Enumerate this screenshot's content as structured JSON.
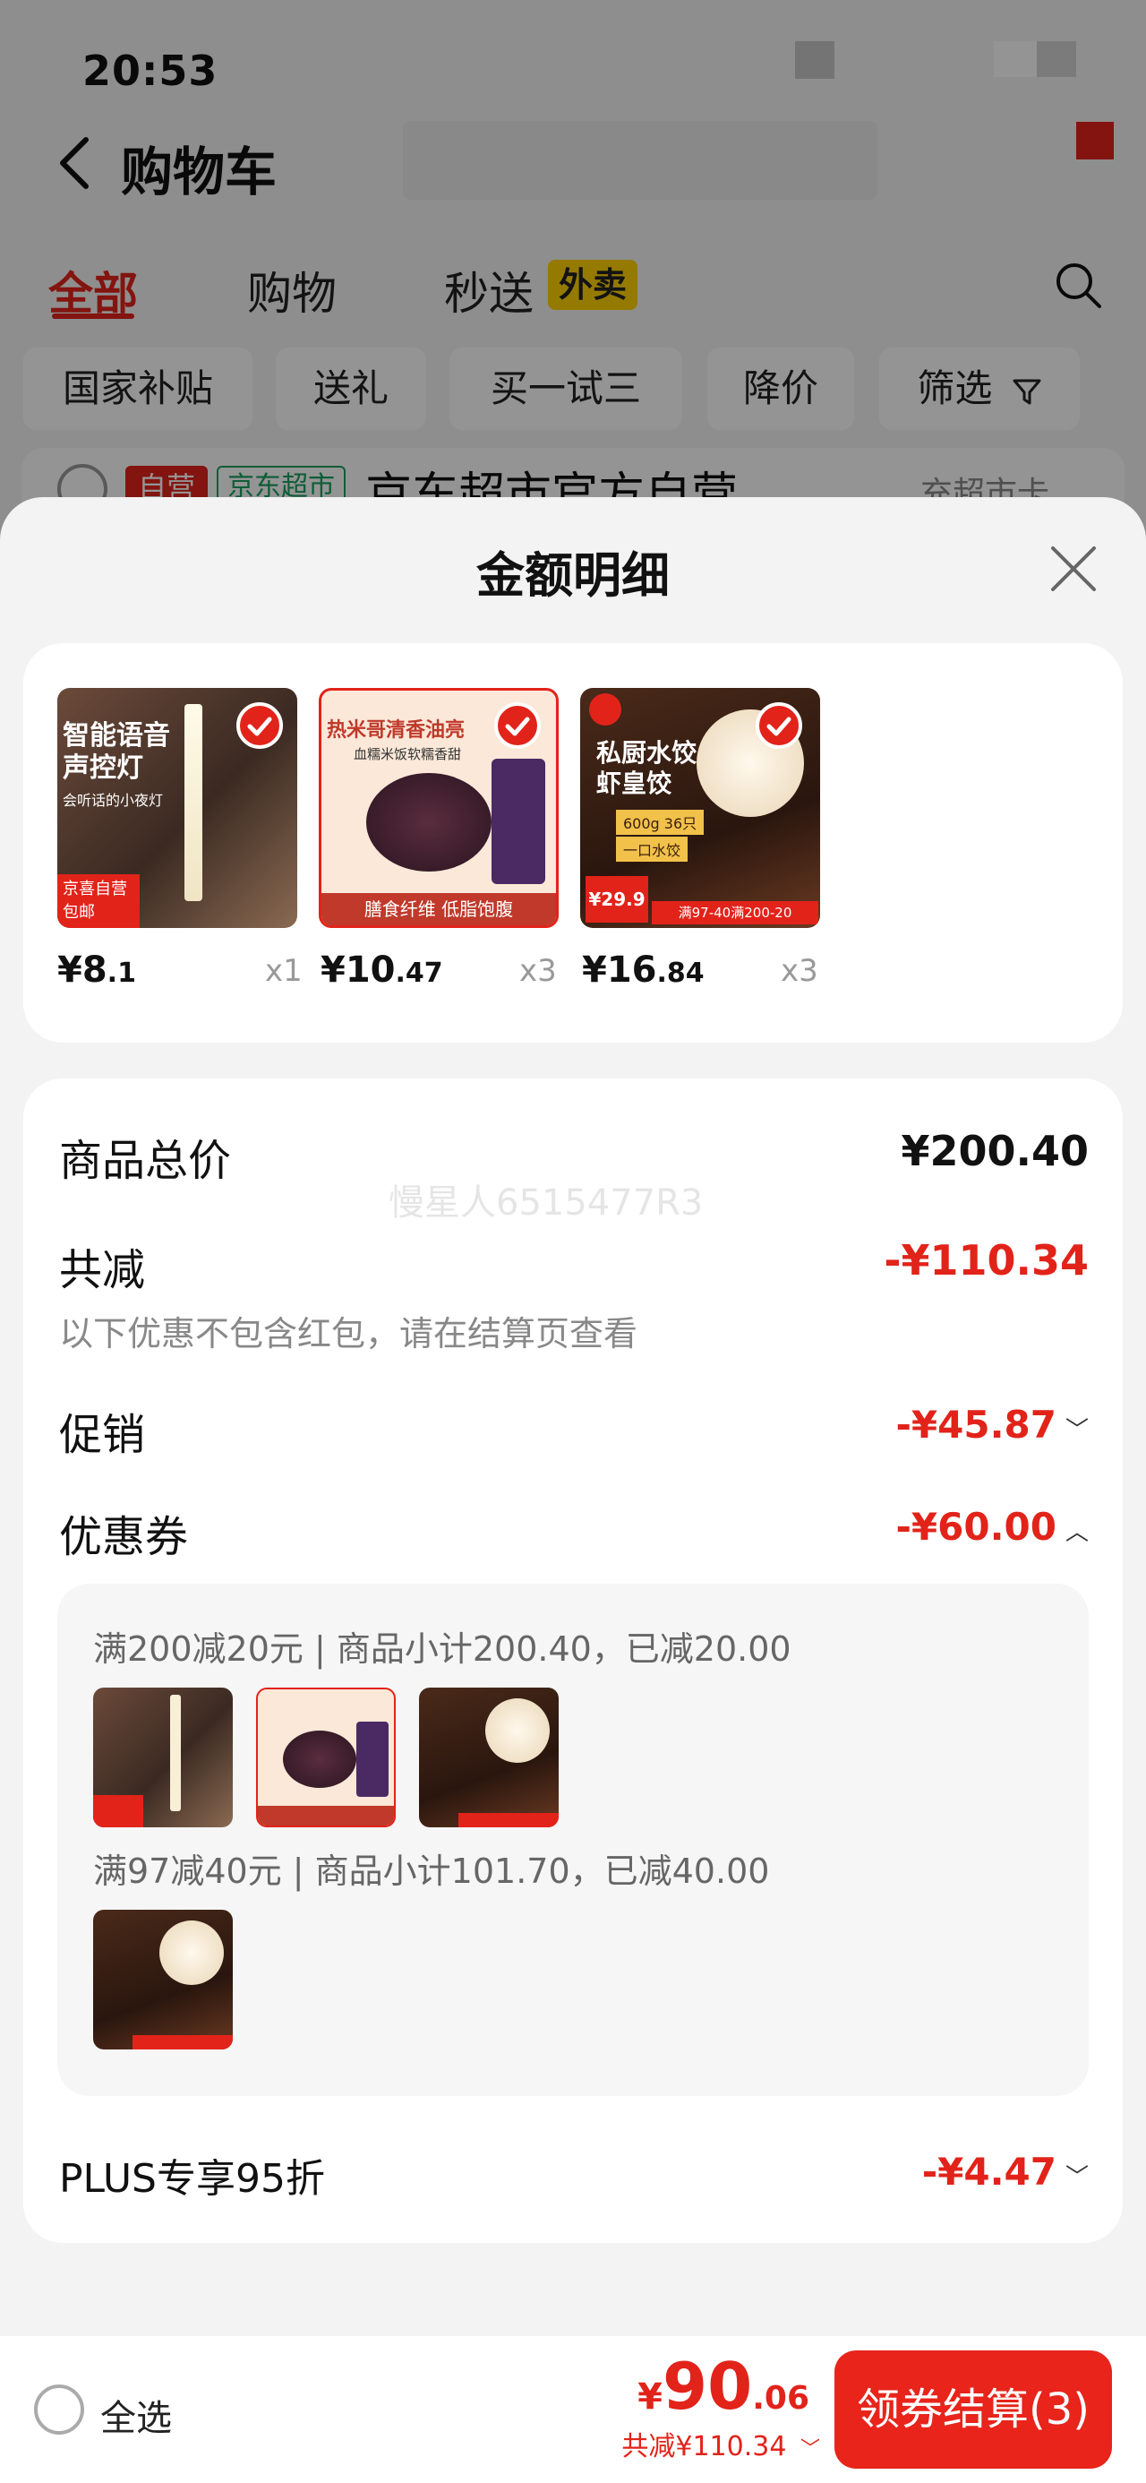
{
  "status_bar": {
    "time": "20:53"
  },
  "cart": {
    "title": "购物车",
    "tabs": [
      "全部",
      "购物",
      "秒送"
    ],
    "takeaway_badge": "外卖",
    "chips": [
      "国家补贴",
      "送礼",
      "买一试三",
      "降价",
      "筛选"
    ],
    "store": {
      "badge_self": "自营",
      "badge_jd": "京东超市",
      "name": "京东超市官方自营",
      "link": "充超市卡"
    }
  },
  "sheet": {
    "title": "金额明细",
    "products": [
      {
        "name": "智能语音声控灯",
        "price_int": "¥8",
        "price_dec": ".1",
        "qty": "x1",
        "selected": true
      },
      {
        "name": "热米哥清香油亮 血糯米饭",
        "price_int": "¥10",
        "price_dec": ".47",
        "qty": "x3",
        "selected": true
      },
      {
        "name": "私厨水饺 虾皇饺",
        "price_int": "¥16",
        "price_dec": ".84",
        "qty": "x3",
        "selected": true
      }
    ],
    "product_img_text": {
      "lamp_title": "智能语音\n声控灯",
      "lamp_sub": "会听话的小夜灯",
      "lamp_tag": "京喜自营\n包邮",
      "rice_top": "热米哥清香油亮",
      "rice_sub": "血糯米饭软糯香甜",
      "rice_bottom": "膳食纤维  低脂饱腹",
      "dumpling_title": "私厨水饺\n虾皇饺",
      "dumpling_tag1": "600g 36只",
      "dumpling_tag2": "一口水饺",
      "dumpling_price": "¥29.9",
      "dumpling_promo": "满97-40满200-20"
    },
    "summary": {
      "total_label": "商品总价",
      "total_value": "¥200.40",
      "reduce_label": "共减",
      "reduce_value": "-¥110.34",
      "reduce_note": "以下优惠不包含红包，请在结算页查看",
      "promo_label": "促销",
      "promo_value": "-¥45.87",
      "coupon_label": "优惠券",
      "coupon_value": "-¥60.00",
      "plus_label": "PLUS专享95折",
      "plus_value": "-¥4.47"
    },
    "watermark": "慢星人6515477R3",
    "coupon_details": [
      {
        "text": "满200减20元 | 商品小计200.40，已减20.00"
      },
      {
        "text": "满97减40元 | 商品小计101.70，已减40.00"
      }
    ]
  },
  "bottom_bar": {
    "select_all": "全选",
    "total_yen": "¥",
    "total_int": "90",
    "total_dec": ".06",
    "total_reduce": "共减¥110.34",
    "checkout": "领券结算(3)"
  },
  "colors": {
    "accent": "#e2231a",
    "badge_yellow": "#ffd200"
  }
}
